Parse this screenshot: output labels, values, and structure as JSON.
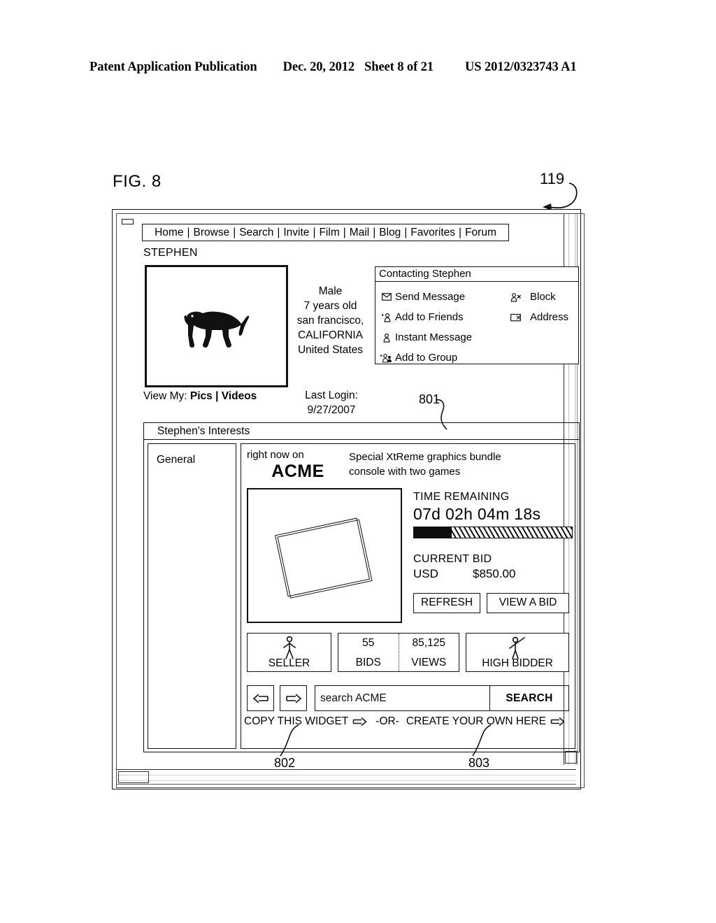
{
  "patent_header": {
    "publication": "Patent Application Publication",
    "date": "Dec. 20, 2012",
    "sheet": "Sheet 8 of 21",
    "number": "US 2012/0323743 A1"
  },
  "figure": {
    "label": "FIG. 8",
    "ref_window": "119",
    "ref_interests": "801",
    "ref_copy_widget": "802",
    "ref_create_own": "803"
  },
  "nav": {
    "items": [
      "Home",
      "Browse",
      "Search",
      "Invite",
      "Film",
      "Mail",
      "Blog",
      "Favorites",
      "Forum"
    ],
    "separator": "|"
  },
  "profile": {
    "username": "STEPHEN",
    "photo_icon": "dog-silhouette-icon",
    "gender": "Male",
    "age": "7 years old",
    "city": "san francisco,",
    "state": "CALIFORNIA",
    "country": "United States",
    "last_login_label": "Last Login:",
    "last_login_date": "9/27/2007",
    "view_my_label": "View My:",
    "view_my_pics": "Pics",
    "view_my_sep": "|",
    "view_my_videos": "Videos"
  },
  "contacting": {
    "title": "Contacting Stephen",
    "left_items": [
      {
        "label": "Send Message",
        "icon": "envelope-icon"
      },
      {
        "label": "Add to Friends",
        "icon": "add-person-icon"
      },
      {
        "label": "Instant Message",
        "icon": "person-icon"
      },
      {
        "label": "Add to Group",
        "icon": "add-group-icon"
      }
    ],
    "right_items": [
      {
        "label": "Block",
        "icon": "block-person-icon"
      },
      {
        "label": "Address",
        "icon": "address-card-icon"
      }
    ]
  },
  "interests": {
    "title": "Stephen's Interests",
    "sidebar_item": "General"
  },
  "widget": {
    "right_now_on": "right now on",
    "brand": "ACME",
    "description_line1": "Special XtReme graphics bundle",
    "description_line2": "console with two games",
    "product_image_icon": "tilted-box-icon",
    "time_remaining_label": "TIME REMAINING",
    "time_remaining_value": "07d 02h 04m 18s",
    "progress_percent": 24,
    "current_bid_label": "CURRENT BID",
    "currency": "USD",
    "bid_amount": "$850.00",
    "refresh_button": "REFRESH",
    "view_bid_button": "VIEW A BID",
    "stats": {
      "seller_label": "SELLER",
      "seller_icon": "stick-figure-icon",
      "bids_value": "55",
      "bids_label": "BIDS",
      "views_value": "85,125",
      "views_label": "VIEWS",
      "high_bidder_label": "HIGH BIDDER",
      "high_bidder_icon": "stick-figure-waving-icon"
    },
    "prev_button_icon": "arrow-left-icon",
    "next_button_icon": "arrow-right-icon",
    "search_placeholder": "search ACME",
    "search_value": "search ACME",
    "search_button": "SEARCH",
    "footer_copy": "COPY THIS WIDGET",
    "footer_or": "-OR-",
    "footer_create": "CREATE YOUR OWN HERE",
    "footer_arrow_icon": "arrow-right-icon"
  },
  "colors": {
    "ink": "#111111",
    "paper": "#ffffff"
  }
}
